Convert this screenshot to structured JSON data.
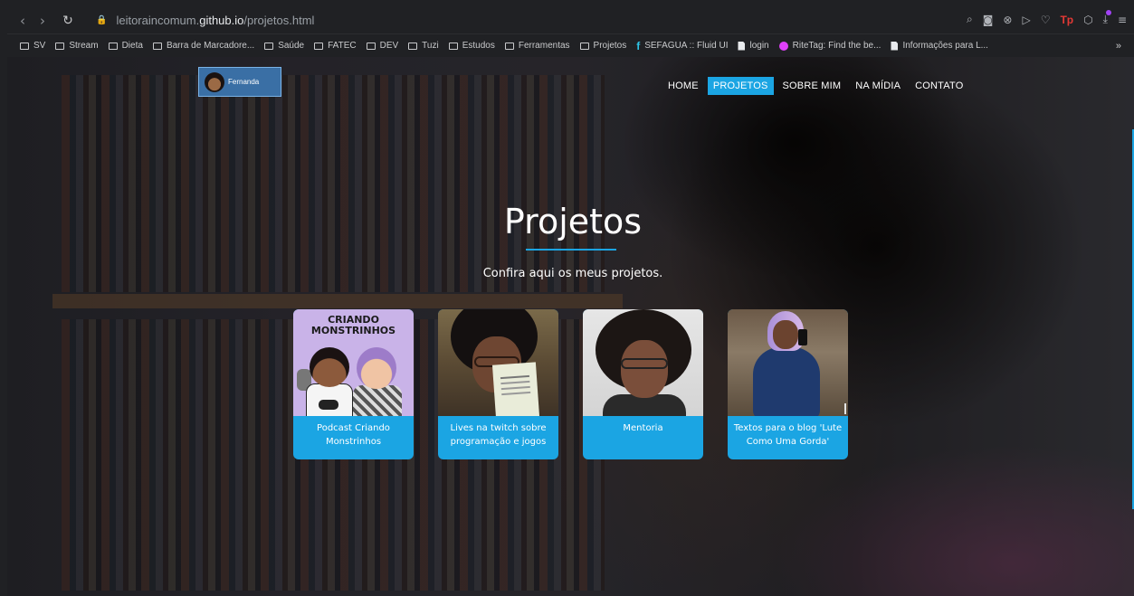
{
  "browser": {
    "url_prefix": "leitoraincomum.",
    "url_domain": "github.io",
    "url_path": "/projetos.html",
    "icons": [
      "back-icon",
      "forward-icon",
      "reload-icon",
      "lock-icon",
      "extensions-icons"
    ],
    "tp_label": "Tp",
    "bookmarks": [
      {
        "label": "SV",
        "icon": "folder-icon"
      },
      {
        "label": "Stream",
        "icon": "folder-icon"
      },
      {
        "label": "Dieta",
        "icon": "folder-icon"
      },
      {
        "label": "Barra de Marcadore...",
        "icon": "folder-icon"
      },
      {
        "label": "Saúde",
        "icon": "folder-icon"
      },
      {
        "label": "FATEC",
        "icon": "folder-icon"
      },
      {
        "label": "DEV",
        "icon": "folder-icon"
      },
      {
        "label": "Tuzi",
        "icon": "folder-icon"
      },
      {
        "label": "Estudos",
        "icon": "folder-icon"
      },
      {
        "label": "Ferramentas",
        "icon": "folder-icon"
      },
      {
        "label": "Projetos",
        "icon": "folder-icon"
      },
      {
        "label": "SEFAGUA :: Fluid UI",
        "icon": "fluid-ui-icon"
      },
      {
        "label": "login",
        "icon": "page-icon"
      },
      {
        "label": "RiteTag: Find the be...",
        "icon": "ritetag-icon"
      },
      {
        "label": "Informações para L...",
        "icon": "page-icon"
      }
    ],
    "more_label": "»"
  },
  "site": {
    "logo_text": "Fernanda",
    "menu": [
      {
        "label": "HOME",
        "active": false
      },
      {
        "label": "PROJETOS",
        "active": true
      },
      {
        "label": "SOBRE MIM",
        "active": false
      },
      {
        "label": "NA MÍDIA",
        "active": false
      },
      {
        "label": "CONTATO",
        "active": false
      }
    ],
    "title": "Projetos",
    "subtitle": "Confira aqui os meus projetos.",
    "cards": [
      {
        "caption": "Podcast Criando Monstrinhos",
        "image_text": "CRIANDO MONSTRINHOS"
      },
      {
        "caption": "Lives na twitch sobre programação e jogos"
      },
      {
        "caption": "Mentoria"
      },
      {
        "caption": "Textos para o blog 'Lute Como Uma Gorda'"
      }
    ]
  },
  "colors": {
    "accent": "#1ba5e3",
    "browser_bg": "#202124"
  }
}
